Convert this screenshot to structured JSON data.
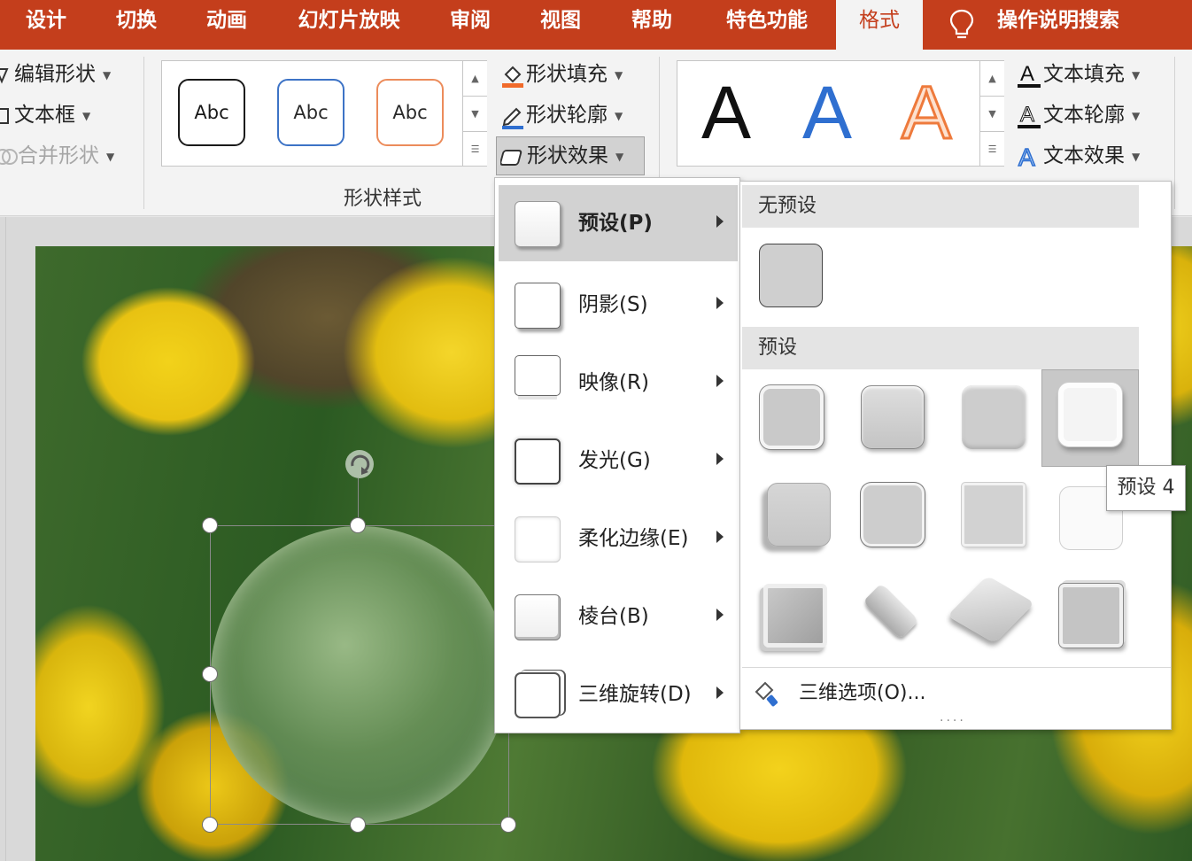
{
  "tabs": [
    {
      "id": "design",
      "label": "设计"
    },
    {
      "id": "transitions",
      "label": "切换"
    },
    {
      "id": "animations",
      "label": "动画"
    },
    {
      "id": "slideshow",
      "label": "幻灯片放映"
    },
    {
      "id": "review",
      "label": "审阅"
    },
    {
      "id": "view",
      "label": "视图"
    },
    {
      "id": "help",
      "label": "帮助"
    },
    {
      "id": "features",
      "label": "特色功能"
    },
    {
      "id": "format",
      "label": "格式",
      "active": true
    }
  ],
  "tell_me": {
    "label": "操作说明搜索",
    "icon": "lightbulb-icon"
  },
  "ribbon": {
    "insert_shapes": {
      "edit_shape": "编辑形状",
      "text_box": "文本框",
      "merge_shapes": "合并形状"
    },
    "shape_styles": {
      "chips": [
        {
          "text": "Abc",
          "border": "#1a1a1a",
          "color": "#1a1a1a"
        },
        {
          "text": "Abc",
          "border": "#3d73c6",
          "color": "#2a2a2a"
        },
        {
          "text": "Abc",
          "border": "#ec8c5b",
          "color": "#2a2a2a"
        }
      ],
      "shape_fill": "形状填充",
      "shape_outline": "形状轮廓",
      "shape_effects": "形状效果",
      "group_label": "形状样式"
    },
    "wordart": {
      "samples": [
        {
          "text": "A",
          "style": "black"
        },
        {
          "text": "A",
          "style": "blue"
        },
        {
          "text": "A",
          "style": "orange-outline"
        }
      ],
      "text_fill": "文本填充",
      "text_outline": "文本轮廓",
      "text_effects": "文本效果"
    }
  },
  "effects_menu": {
    "items": [
      {
        "label": "预设(P)",
        "icon": "preset-icon",
        "highlighted": true
      },
      {
        "label": "阴影(S)",
        "icon": "shadow-icon"
      },
      {
        "label": "映像(R)",
        "icon": "reflection-icon"
      },
      {
        "label": "发光(G)",
        "icon": "glow-icon"
      },
      {
        "label": "柔化边缘(E)",
        "icon": "soft-edges-icon"
      },
      {
        "label": "棱台(B)",
        "icon": "bevel-icon"
      },
      {
        "label": "三维旋转(D)",
        "icon": "3d-rotation-icon"
      }
    ]
  },
  "preset_panel": {
    "no_preset_heading": "无预设",
    "preset_heading": "预设",
    "selected_preset": 4,
    "tooltip": "预设 4",
    "options_3d": "三维选项(O)...",
    "grip": "...."
  },
  "colors": {
    "accent": "#c43e1c",
    "ribbon_bg": "#f3f3f3",
    "menu_highlight": "#d2d2d2"
  }
}
